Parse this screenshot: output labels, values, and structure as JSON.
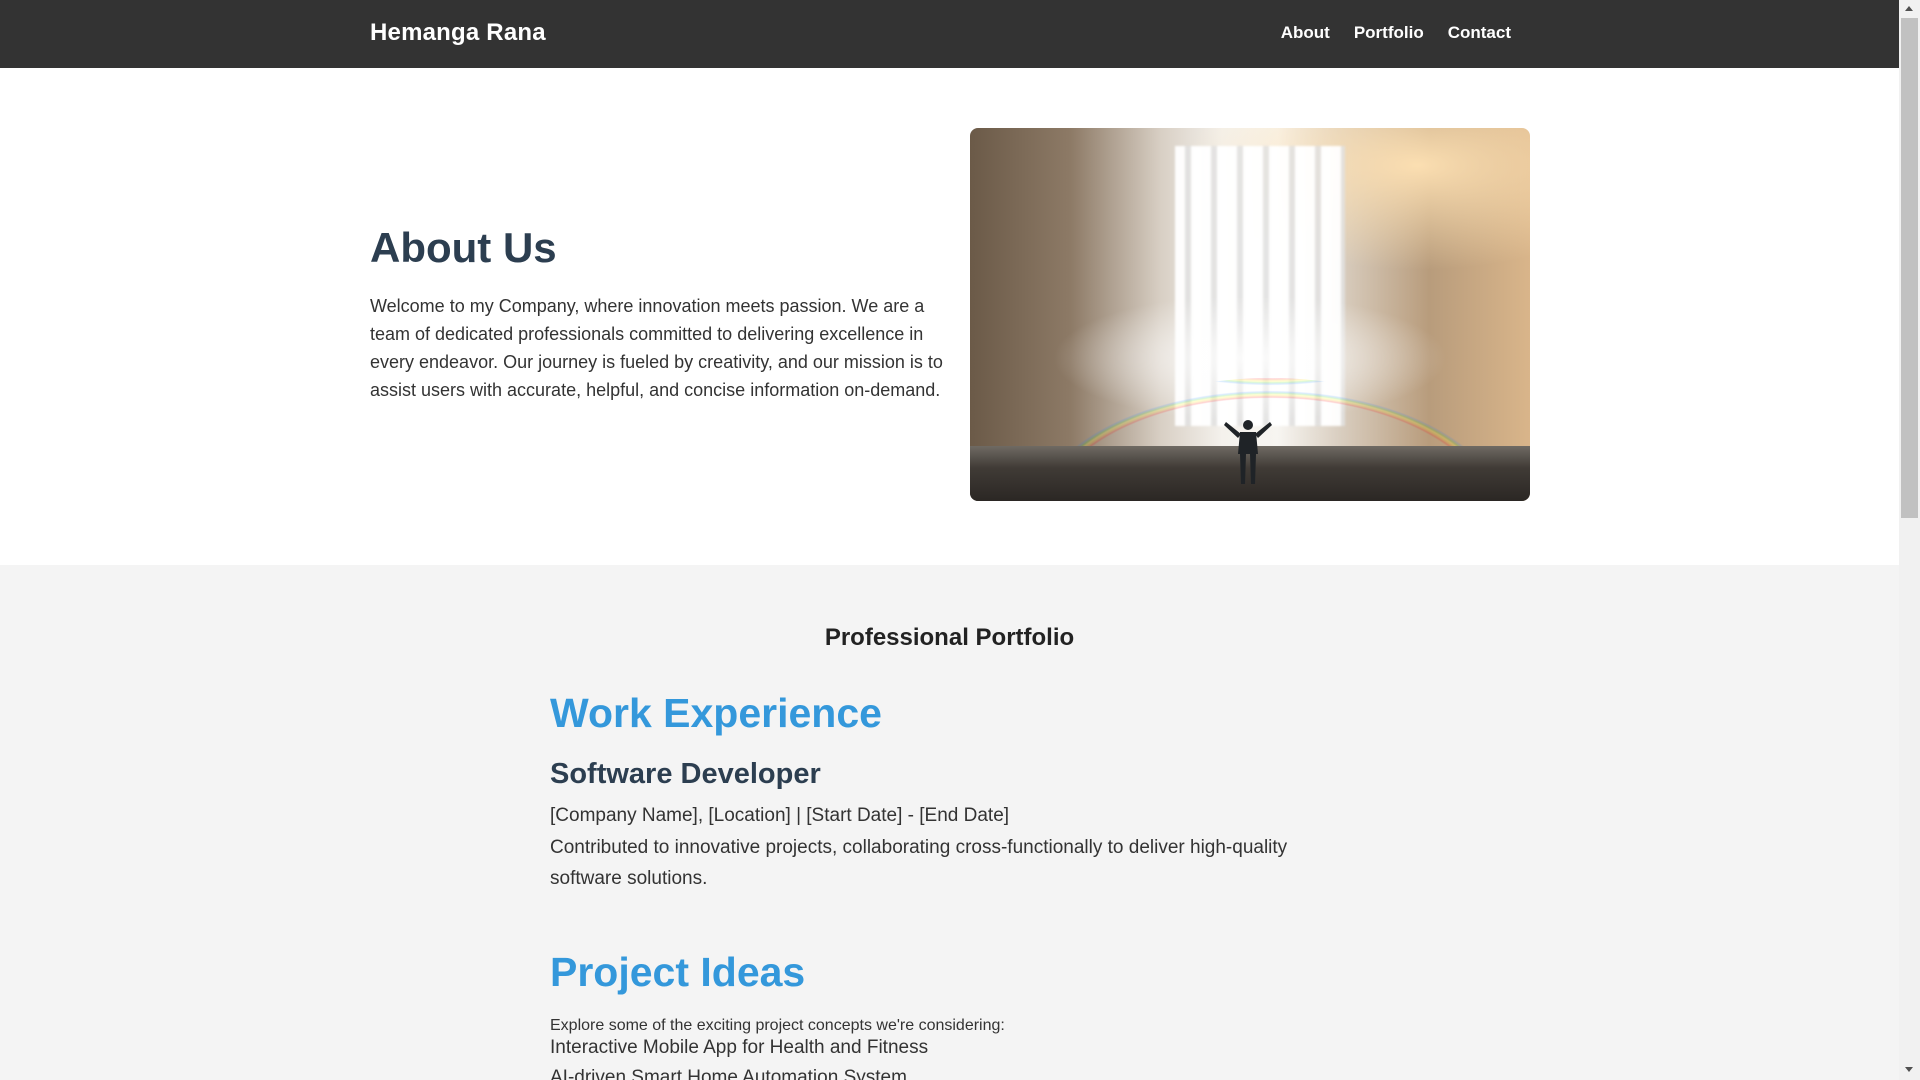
{
  "header": {
    "brand": "Hemanga Rana",
    "nav": [
      "About",
      "Portfolio",
      "Contact"
    ]
  },
  "about": {
    "title": "About Us",
    "text": "Welcome to my Company, where innovation meets passion. We are a team of dedicated professionals committed to delivering excellence in every endeavor. Our journey is fueled by creativity, and our mission is to assist users with accurate, helpful, and concise information on-demand."
  },
  "portfolio": {
    "title": "Professional Portfolio",
    "work": {
      "heading": "Work Experience",
      "job_title": "Software Developer",
      "meta": "[Company Name], [Location] | [Start Date] - [End Date]",
      "description": "Contributed to innovative projects, collaborating cross-functionally to deliver high-quality software solutions."
    },
    "projects": {
      "heading": "Project Ideas",
      "intro": "Explore some of the exciting project concepts we're considering:",
      "items": [
        "Interactive Mobile App for Health and Fitness",
        "AI-driven Smart Home Automation System"
      ]
    }
  },
  "colors": {
    "navbar_bg": "#333333",
    "heading_dark": "#2c3e50",
    "accent_blue": "#3498db",
    "section_bg": "#f4f4f4"
  }
}
